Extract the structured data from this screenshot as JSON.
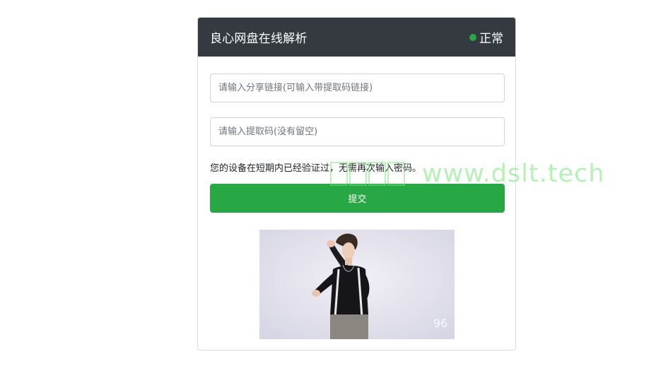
{
  "header": {
    "title": "良心网盘在线解析",
    "status_label": "正常",
    "status_color": "#28a745"
  },
  "form": {
    "share_link_placeholder": "请输入分享链接(可输入带提取码链接)",
    "extract_code_placeholder": "请输入提取码(没有留空)",
    "notice": "您的设备在短期内已经验证过，无需再次输入密码。",
    "submit_label": "提交",
    "submit_color": "#28a745"
  },
  "image": {
    "corner_mark": "96"
  },
  "watermark": {
    "text": "www.dslt.tech"
  },
  "icons": {
    "status": "status-dot-icon"
  }
}
